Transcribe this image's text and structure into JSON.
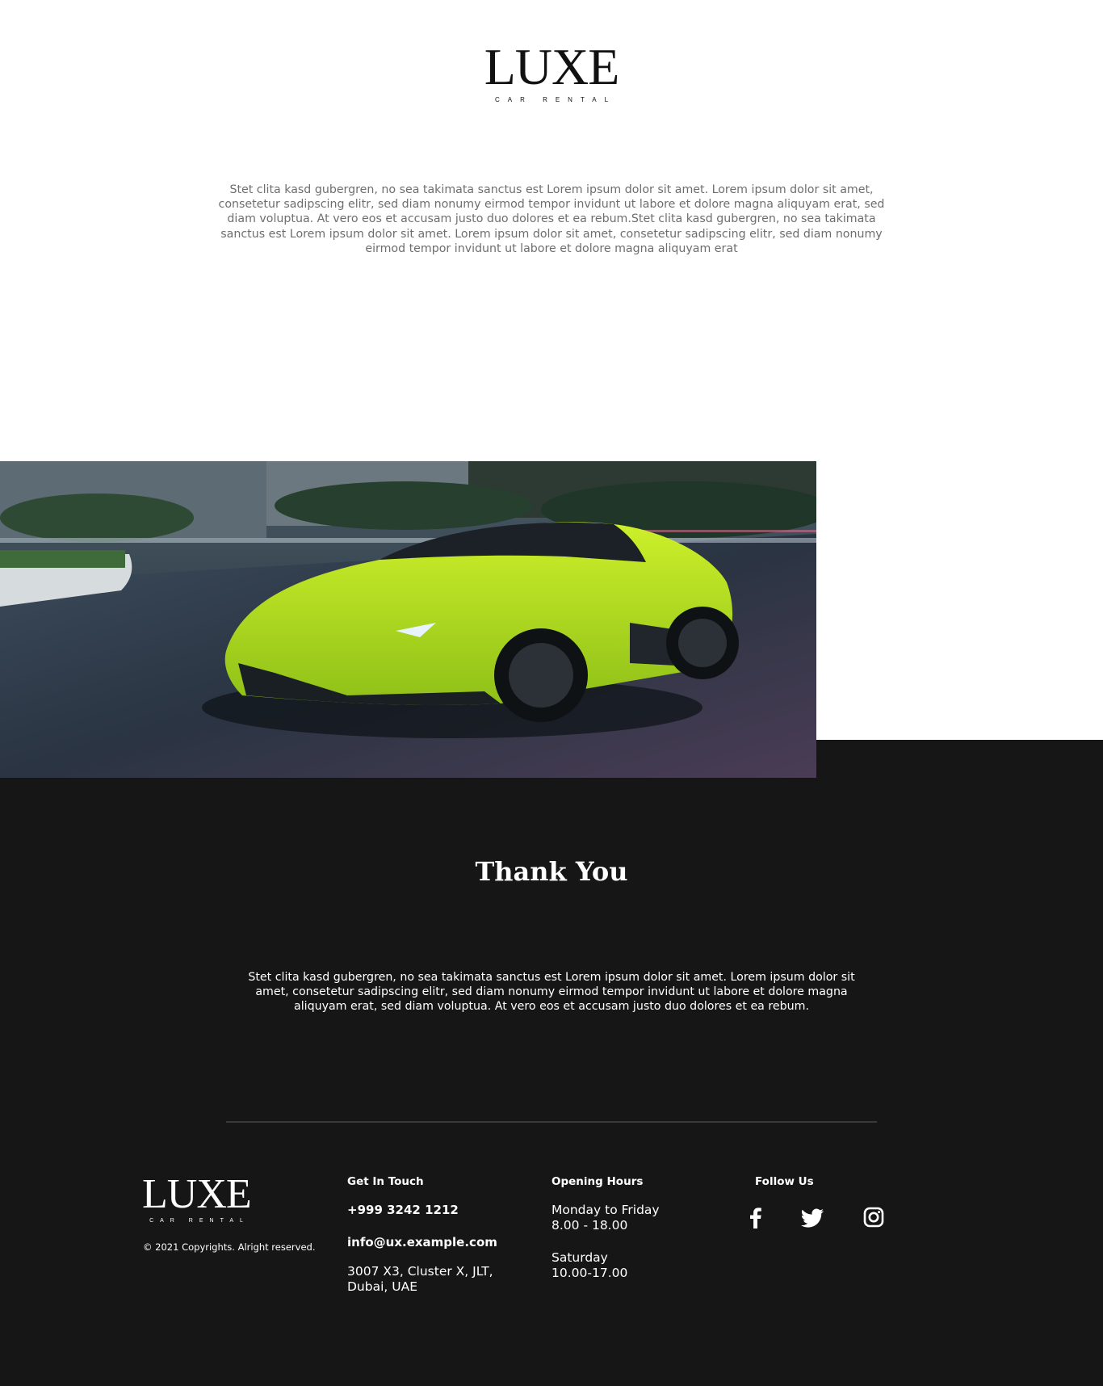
{
  "brand": {
    "name": "LUXE",
    "tagline": "CAR RENTAL"
  },
  "intro": {
    "text": "Stet clita kasd gubergren, no sea takimata sanctus est Lorem ipsum dolor sit amet. Lorem ipsum dolor sit amet, consetetur sadipscing elitr, sed diam nonumy eirmod tempor invidunt ut labore et dolore magna aliquyam erat, sed diam voluptua. At vero eos et accusam justo duo dolores et ea rebum.Stet clita kasd gubergren, no sea takimata sanctus est Lorem ipsum dolor sit amet. Lorem ipsum dolor sit amet, consetetur sadipscing elitr, sed diam nonumy eirmod tempor invidunt ut labore et dolore magna aliquyam erat"
  },
  "hero": {
    "icon": "sports-car-image",
    "car_color": "#b5e61d"
  },
  "thanks": {
    "title": "Thank You",
    "text": "Stet clita kasd gubergren, no sea takimata sanctus est Lorem ipsum dolor sit amet. Lorem ipsum dolor sit amet, consetetur sadipscing elitr, sed diam nonumy eirmod tempor invidunt ut labore et dolore magna aliquyam erat, sed diam voluptua. At vero eos et accusam justo duo dolores et ea rebum."
  },
  "footer": {
    "copyright": "© 2021 Copyrights. Alright reserved.",
    "contact": {
      "heading": "Get In Touch",
      "phone": "+999 3242 1212",
      "email": "info@ux.example.com",
      "address": "3007 X3, Cluster X, JLT, Dubai, UAE"
    },
    "hours": {
      "heading": "Opening Hours",
      "weekday_label": "Monday to Friday",
      "weekday_time": "8.00 - 18.00",
      "saturday_label": "Saturday",
      "saturday_time": "10.00-17.00"
    },
    "social": {
      "heading": "Follow Us",
      "icons": [
        "facebook-icon",
        "twitter-icon",
        "instagram-icon"
      ]
    }
  },
  "colors": {
    "dark_bg": "#161616",
    "text_muted": "#6e6e6e",
    "white": "#ffffff"
  }
}
